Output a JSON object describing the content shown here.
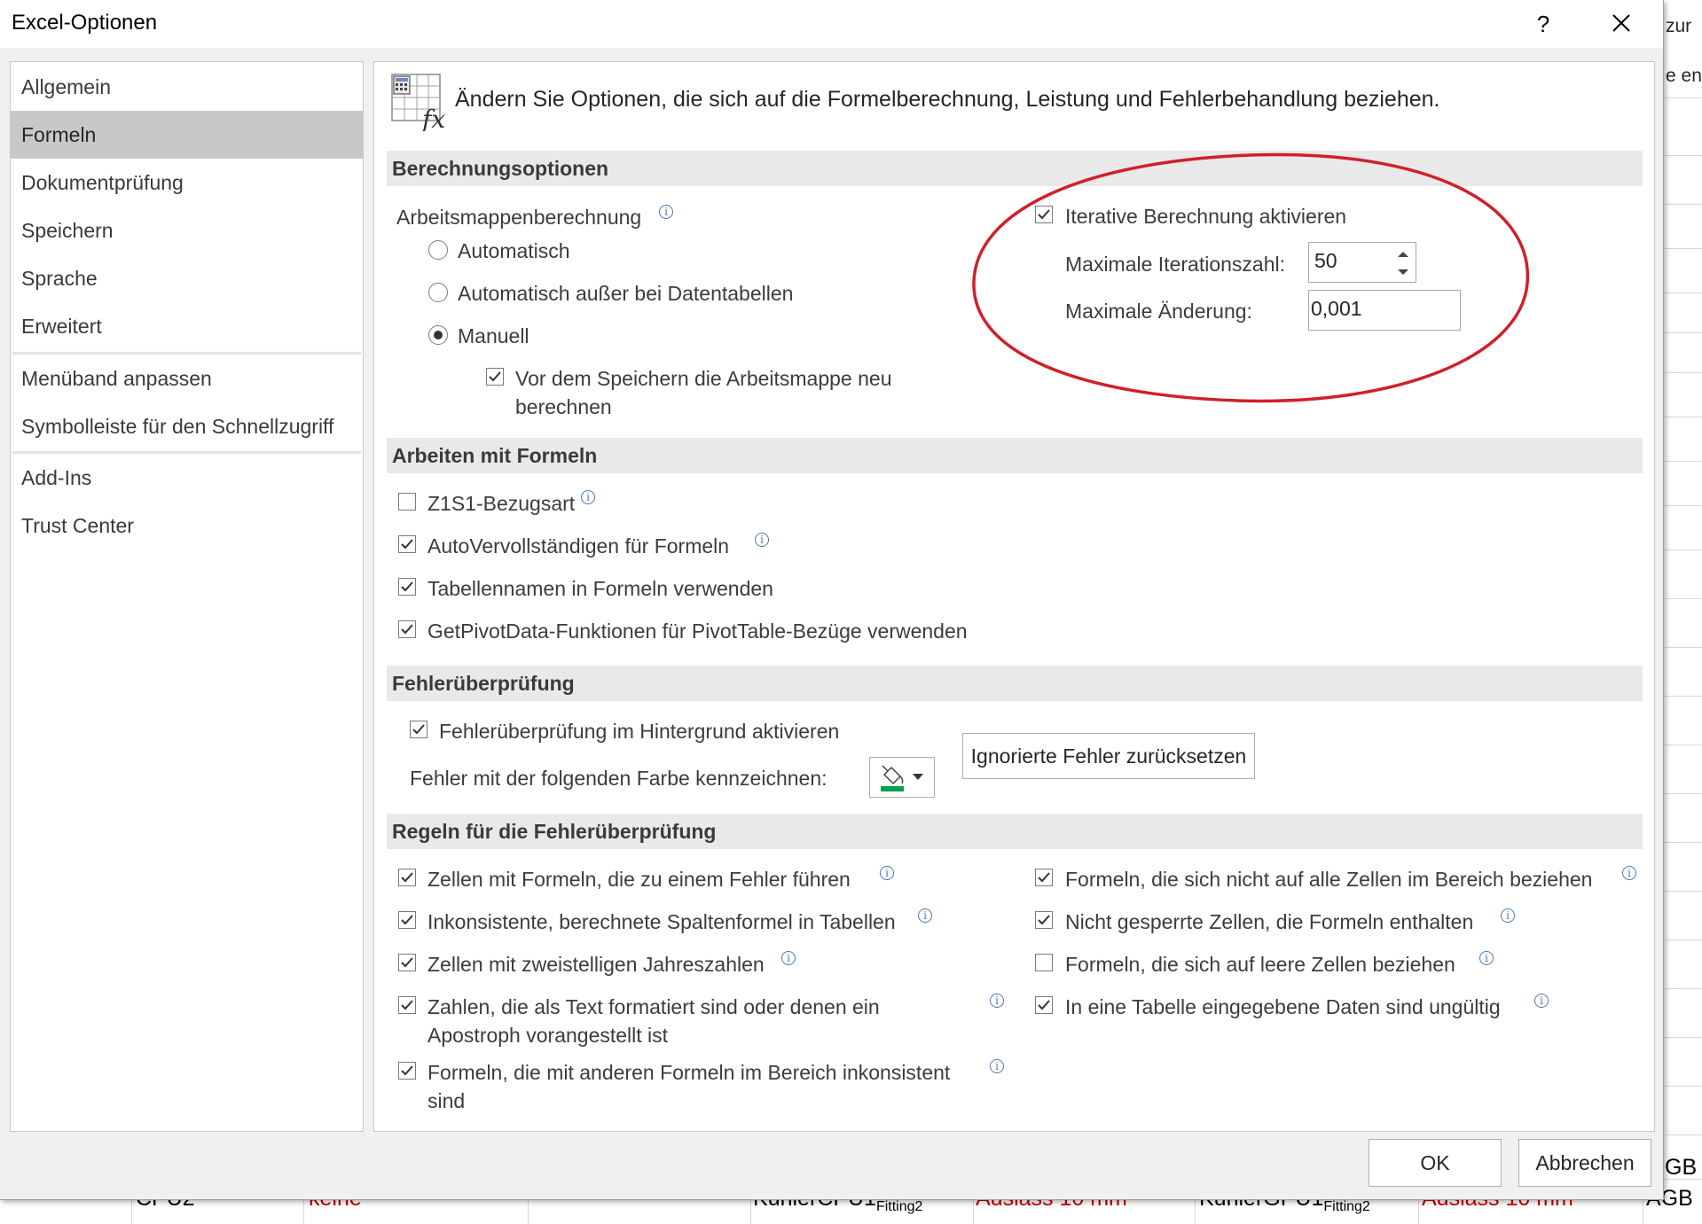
{
  "window": {
    "title": "Excel-Optionen",
    "help_label": "?"
  },
  "nav": {
    "items": [
      "Allgemein",
      "Formeln",
      "Dokumentprüfung",
      "Speichern",
      "Sprache",
      "Erweitert",
      "Menüband anpassen",
      "Symbolleiste für den Schnellzugriff",
      "Add-Ins",
      "Trust Center"
    ],
    "selected": "Formeln"
  },
  "intro": "Ändern Sie Optionen, die sich auf die Formelberechnung, Leistung und Fehlerbehandlung beziehen.",
  "calc": {
    "header": "Berechnungsoptionen",
    "workbook_label": "Arbeitsmappenberechnung",
    "radio_auto": "Automatisch",
    "radio_auto_except": "Automatisch außer bei Datentabellen",
    "radio_manual": "Manuell",
    "selected_radio": "Manuell",
    "recalc_line1": "Vor dem Speichern die Arbeitsmappe neu",
    "recalc_line2": "berechnen",
    "recalc_checked": true,
    "iterative_label": "Iterative Berechnung aktivieren",
    "iterative_checked": true,
    "max_iter_label": "Maximale Iterationszahl:",
    "max_iter_value": "50",
    "max_change_label": "Maximale Änderung:",
    "max_change_value": "0,001"
  },
  "formulas": {
    "header": "Arbeiten mit Formeln",
    "r1c1": "Z1S1-Bezugsart",
    "autocomplete": "AutoVervollständigen für Formeln",
    "table_names": "Tabellennamen in Formeln verwenden",
    "getpivot": "GetPivotData-Funktionen für PivotTable-Bezüge verwenden"
  },
  "errorcheck": {
    "header": "Fehlerüberprüfung",
    "background": "Fehlerüberprüfung im Hintergrund aktivieren",
    "color_label": "Fehler mit der folgenden Farbe kennzeichnen:",
    "reset_button": "Ignorierte Fehler zurücksetzen",
    "indicator_color": "#00a050"
  },
  "rules": {
    "header": "Regeln für die Fehlerüberprüfung",
    "left": [
      {
        "line1": "Zellen mit Formeln, die zu einem Fehler führen",
        "line2": "",
        "checked": true
      },
      {
        "line1": "Inkonsistente, berechnete Spaltenformel in Tabellen",
        "line2": "",
        "checked": true
      },
      {
        "line1": "Zellen mit zweistelligen Jahreszahlen",
        "line2": "",
        "checked": true
      },
      {
        "line1": "Zahlen, die als Text formatiert sind oder denen ein",
        "line2": "Apostroph vorangestellt ist",
        "checked": true
      },
      {
        "line1": "Formeln, die mit anderen Formeln im Bereich inkonsistent",
        "line2": "sind",
        "checked": true
      }
    ],
    "right": [
      {
        "line1": "Formeln, die sich nicht auf alle Zellen im Bereich beziehen",
        "checked": true
      },
      {
        "line1": "Nicht gesperrte Zellen, die Formeln enthalten",
        "checked": true
      },
      {
        "line1": "Formeln, die sich auf leere Zellen beziehen",
        "checked": false
      },
      {
        "line1": "In eine Tabelle eingegebene Daten sind ungültig",
        "checked": true
      }
    ]
  },
  "buttons": {
    "ok": "OK",
    "cancel": "Abbrechen"
  },
  "background_sheet": {
    "right_texts": [
      "zur",
      "e en",
      "GB",
      "AGB"
    ],
    "cells": [
      "CPU2",
      "keine",
      "KühlerCPU1",
      "Fitting2",
      "Auslass 10 mm",
      "KühlerGPU1",
      "Fitting2",
      "Auslass 10 mm"
    ]
  },
  "annotation_color": "#d0202a"
}
